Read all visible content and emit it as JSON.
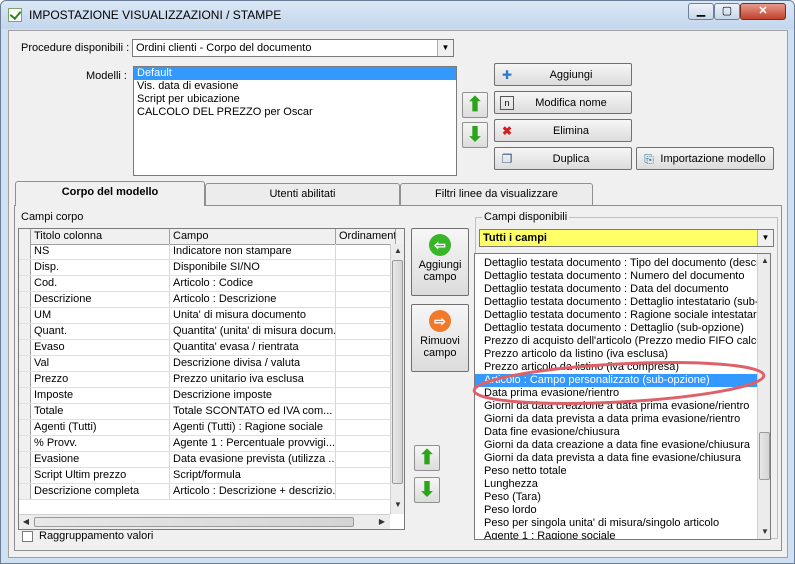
{
  "window": {
    "title": "IMPOSTAZIONE VISUALIZZAZIONI / STAMPE",
    "min_label": "▁",
    "max_label": "▢",
    "close_label": "✕"
  },
  "procedure": {
    "label": "Procedure disponibili :",
    "value": "Ordini clienti - Corpo del documento"
  },
  "modelli": {
    "label": "Modelli :",
    "items": [
      "Default",
      "Vis. data di evasione",
      "Script per ubicazione",
      "CALCOLO DEL PREZZO per Oscar"
    ],
    "selected_index": 0
  },
  "buttons": {
    "aggiungi": "Aggiungi",
    "modifica_nome": "Modifica nome",
    "elimina": "Elimina",
    "duplica": "Duplica",
    "importazione_modello": "Importazione modello"
  },
  "tabs": [
    {
      "label": "Corpo del modello",
      "active": true
    },
    {
      "label": "Utenti abilitati",
      "active": false
    },
    {
      "label": "Filtri linee da visualizzare",
      "active": false
    }
  ],
  "campi_corpo": {
    "label": "Campi corpo",
    "columns": [
      "Titolo colonna",
      "Campo",
      "Ordinamento"
    ],
    "rows": [
      [
        "NS",
        "Indicatore non stampare"
      ],
      [
        "Disp.",
        "Disponibile SI/NO"
      ],
      [
        "Cod.",
        "Articolo : Codice"
      ],
      [
        "Descrizione",
        "Articolo : Descrizione"
      ],
      [
        "UM",
        "Unita' di misura documento"
      ],
      [
        "Quant.",
        "Quantita' (unita' di misura docum..."
      ],
      [
        "Evaso",
        "Quantita' evasa / rientrata"
      ],
      [
        "Val",
        "Descrizione divisa / valuta"
      ],
      [
        "Prezzo",
        "Prezzo unitario iva esclusa"
      ],
      [
        "Imposte",
        "Descrizione imposte"
      ],
      [
        "Totale",
        "Totale SCONTATO ed IVA com..."
      ],
      [
        "Agenti (Tutti)",
        "Agenti (Tutti) : Ragione sociale"
      ],
      [
        "% Provv.",
        "Agente 1 : Percentuale provvigi..."
      ],
      [
        "Evasione",
        "Data evasione prevista (utilizza ..."
      ],
      [
        "Script Ultim prezzo",
        "Script/formula"
      ],
      [
        "Descrizione completa",
        "Articolo : Descrizione + descrizio..."
      ]
    ]
  },
  "middle_buttons": {
    "aggiungi_campo": "Aggiungi campo",
    "rimuovi_campo": "Rimuovi campo"
  },
  "campi_disponibili": {
    "label": "Campi disponibili",
    "filter": "Tutti i campi",
    "items": [
      "Dettaglio testata documento : Tipo del documento (descri",
      "Dettaglio testata documento : Numero del documento",
      "Dettaglio testata documento : Data del documento",
      "Dettaglio testata documento : Dettaglio intestatario (sub-o",
      "Dettaglio testata documento : Ragione sociale intestatario",
      "Dettaglio testata documento : Dettaglio (sub-opzione)",
      "Prezzo di acquisto dell'articolo (Prezzo medio FIFO calcola",
      "Prezzo articolo da listino (iva esclusa)",
      "Prezzo articolo da listino (iva compresa)",
      "Articolo : Campo personalizzato (sub-opzione)",
      "Data prima evasione/rientro",
      "Giorni da data creazione a data prima evasione/rientro",
      "Giorni da data prevista a data prima evasione/rientro",
      "Data fine evasione/chiusura",
      "Giorni da data creazione a data fine evasione/chiusura",
      "Giorni da data prevista a data fine evasione/chiusura",
      "Peso netto totale",
      "Lunghezza",
      "Peso (Tara)",
      "Peso lordo",
      "Peso per singola unita' di misura/singolo articolo",
      "Agente 1 : Ragione sociale"
    ],
    "selected_index": 9
  },
  "raggruppamento": {
    "label": "Raggruppamento valori",
    "checked": false
  },
  "colors": {
    "selection": "#3399ff",
    "filter_bg": "#ffff66",
    "highlight_ellipse": "#e0606a",
    "green_arrow": "#2aa51a"
  }
}
